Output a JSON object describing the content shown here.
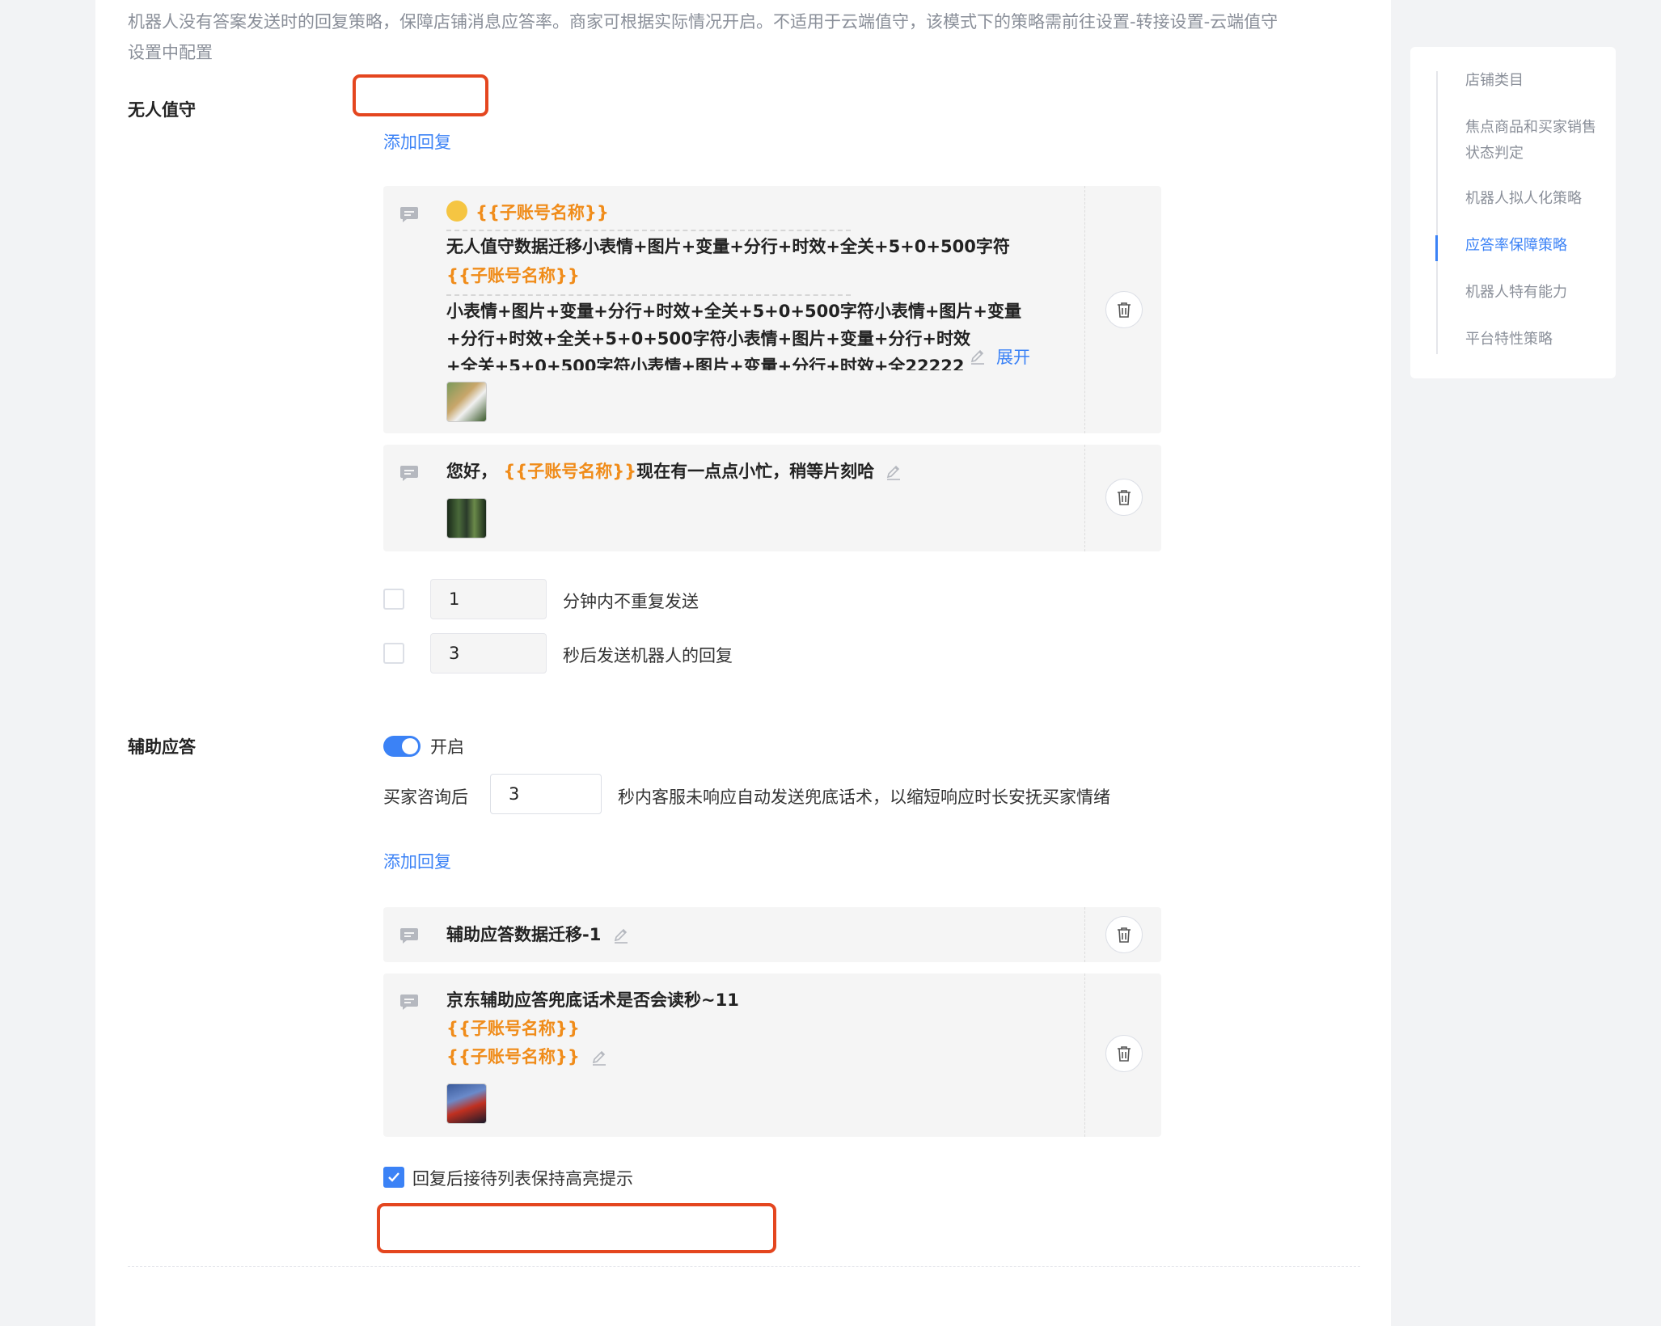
{
  "description": {
    "line1": "机器人没有答案发送时的回复策略，保障店铺消息应答率。商家可根据实际情况开启。不适用于云端值守，该模式下的策略需前往设置-转接设置-云端值守",
    "line2": "设置中配置"
  },
  "unattended": {
    "label": "无人值守",
    "add_reply": "添加回复",
    "cards": [
      {
        "var1": "{{子账号名称}}",
        "line1": "无人值守数据迁移小表情+图片+变量+分行+时效+全关+5+0+500字符",
        "var2": "{{子账号名称}}",
        "line2": "小表情+图片+变量+分行+时效+全关+5+0+500字符小表情+图片+变量",
        "line3": "+分行+时效+全关+5+0+500字符小表情+图片+变量+分行+时效",
        "line4": "+全关+5+0+500字符小表情+图片+变量+分行+时效+全22222",
        "expand": "展开"
      },
      {
        "prefix": "您好，",
        "var": "{{子账号名称}}",
        "suffix": "现在有一点点小忙，稍等片刻哈"
      }
    ],
    "no_repeat_value": "1",
    "no_repeat_label": "分钟内不重复发送",
    "delay_value": "3",
    "delay_label": "秒后发送机器人的回复"
  },
  "assist": {
    "label": "辅助应答",
    "toggle_label": "开启",
    "prefix": "买家咨询后",
    "seconds": "3",
    "suffix": "秒内客服未响应自动发送兜底话术，以缩短响应时长安抚买家情绪",
    "add_reply": "添加回复",
    "cards": [
      {
        "text": "辅助应答数据迁移-1"
      },
      {
        "text": "京东辅助应答兜底话术是否会读秒~11",
        "var1": "{{子账号名称}}",
        "var2": "{{子账号名称}}"
      }
    ],
    "highlight_label": "回复后接待列表保持高亮提示"
  },
  "sidebar": {
    "items": [
      {
        "label": "店铺类目"
      },
      {
        "label": "焦点商品和买家销售状态判定"
      },
      {
        "label": "机器人拟人化策略"
      },
      {
        "label": "应答率保障策略"
      },
      {
        "label": "机器人特有能力"
      },
      {
        "label": "平台特性策略"
      }
    ]
  },
  "colors": {
    "accent": "#3b82f6",
    "variable": "#f08c1a",
    "annotation": "#e4461f"
  }
}
